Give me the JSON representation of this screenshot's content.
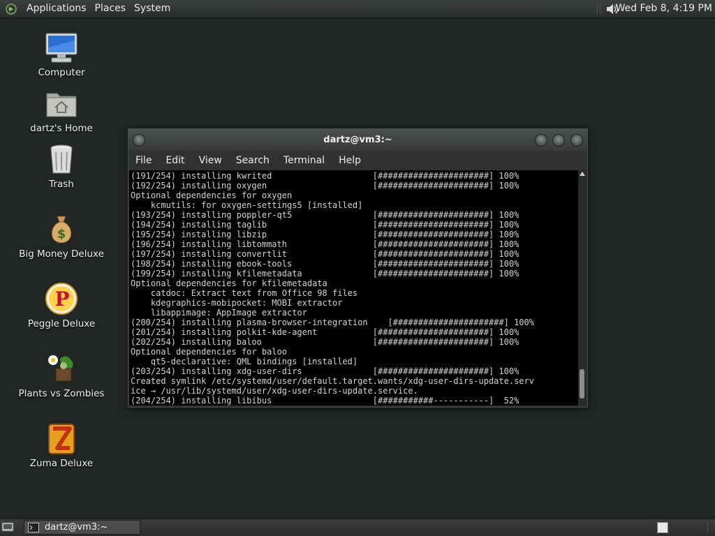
{
  "top_panel": {
    "menus": [
      "Applications",
      "Places",
      "System"
    ],
    "clock": "Wed Feb  8,  4:19 PM"
  },
  "desktop_icons": [
    {
      "label": "Computer",
      "icon": "computer-icon"
    },
    {
      "label": "dartz's Home",
      "icon": "home-folder-icon"
    },
    {
      "label": "Trash",
      "icon": "trash-icon"
    },
    {
      "label": "Big Money Deluxe",
      "icon": "money-bag-icon"
    },
    {
      "label": "Peggle Deluxe",
      "icon": "peggle-icon"
    },
    {
      "label": "Plants vs Zombies",
      "icon": "plants-vs-zombies-icon"
    },
    {
      "label": "Zuma Deluxe",
      "icon": "zuma-icon"
    }
  ],
  "terminal": {
    "title": "dartz@vm3:~",
    "menu": [
      "File",
      "Edit",
      "View",
      "Search",
      "Terminal",
      "Help"
    ],
    "output": "(191/254) installing kwrited                    [######################] 100%\n(192/254) installing oxygen                     [######################] 100%\nOptional dependencies for oxygen\n    kcmutils: for oxygen-settings5 [installed]\n(193/254) installing poppler-qt5                [######################] 100%\n(194/254) installing taglib                     [######################] 100%\n(195/254) installing libzip                     [######################] 100%\n(196/254) installing libtommath                 [######################] 100%\n(197/254) installing convertlit                 [######################] 100%\n(198/254) installing ebook-tools                [######################] 100%\n(199/254) installing kfilemetadata              [######################] 100%\nOptional dependencies for kfilemetadata\n    catdoc: Extract text from Office 98 files\n    kdegraphics-mobipocket: MOBI extractor\n    libappimage: AppImage extractor\n(200/254) installing plasma-browser-integration    [######################] 100%\n(201/254) installing polkit-kde-agent           [######################] 100%\n(202/254) installing baloo                      [######################] 100%\nOptional dependencies for baloo\n    qt5-declarative: QML bindings [installed]\n(203/254) installing xdg-user-dirs              [######################] 100%\nCreated symlink /etc/systemd/user/default.target.wants/xdg-user-dirs-update.serv\nice → /usr/lib/systemd/user/xdg-user-dirs-update.service.\n(204/254) installing libibus                    [###########-----------]  52%"
  },
  "taskbar": {
    "window_title": "dartz@vm3:~"
  }
}
